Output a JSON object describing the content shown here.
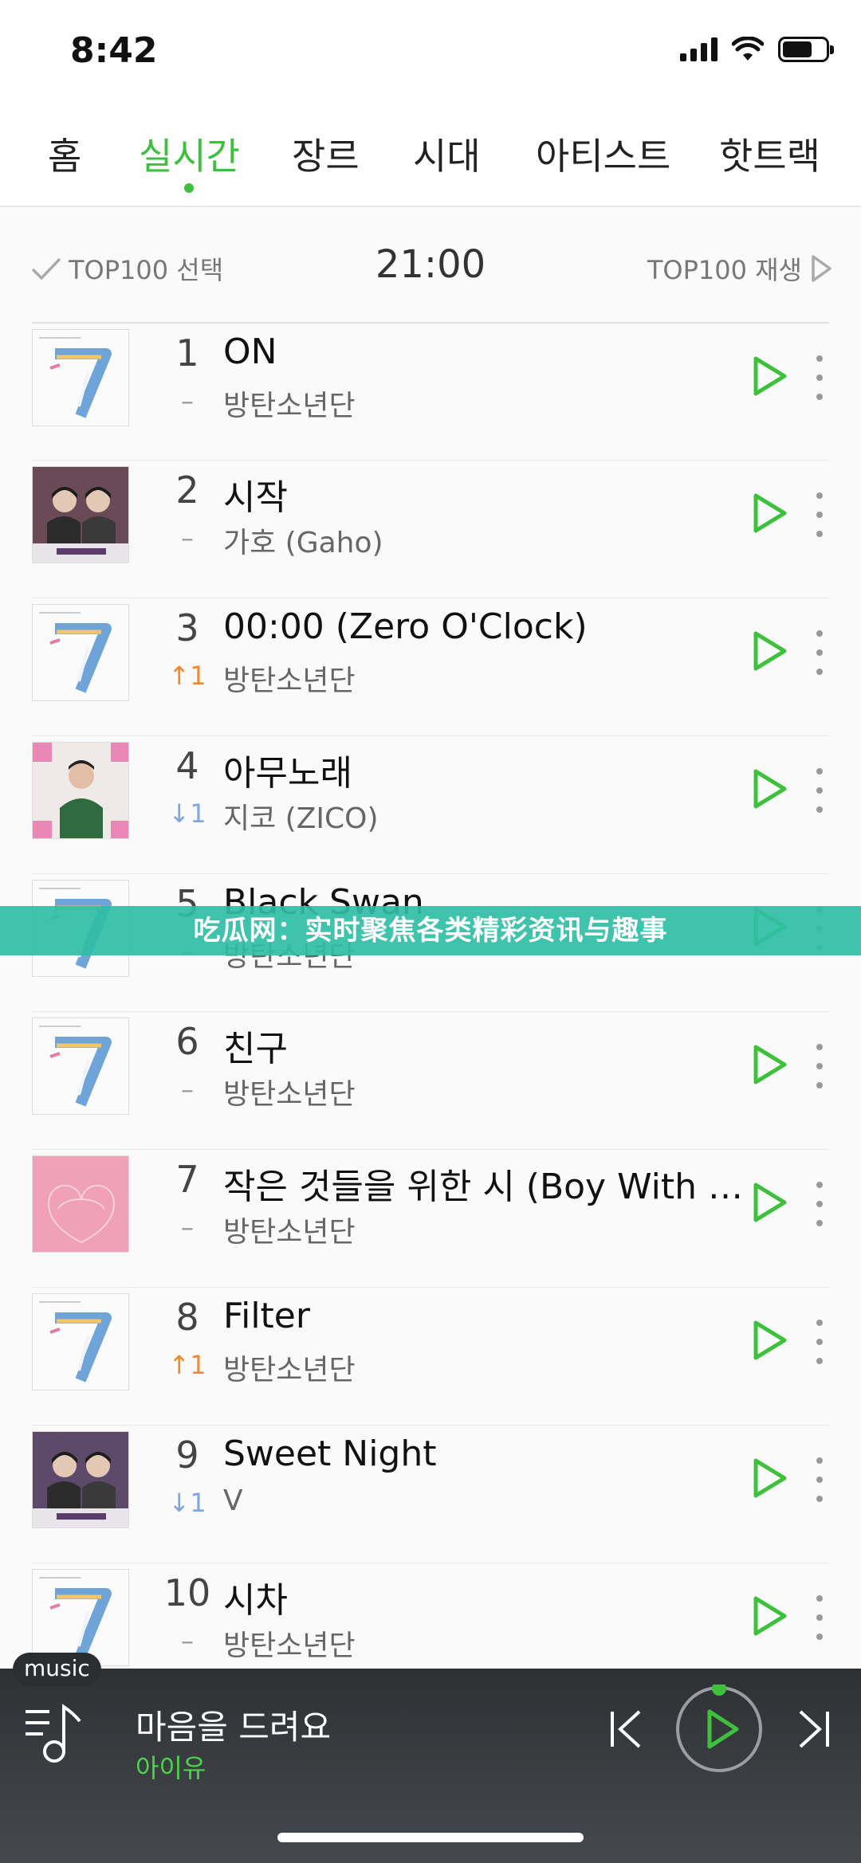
{
  "status": {
    "time": "8:42"
  },
  "tabs": [
    {
      "label": "홈",
      "active": false
    },
    {
      "label": "실시간",
      "active": true
    },
    {
      "label": "장르",
      "active": false
    },
    {
      "label": "시대",
      "active": false
    },
    {
      "label": "아티스트",
      "active": false
    },
    {
      "label": "핫트랙",
      "active": false
    }
  ],
  "subheader": {
    "select_label": "TOP100 선택",
    "time": "21:00",
    "play_label": "TOP100 재생"
  },
  "songs": [
    {
      "rank": "1",
      "change": "–",
      "change_dir": "none",
      "title": "ON",
      "artist": "방탄소년단",
      "cover": "bts7"
    },
    {
      "rank": "2",
      "change": "–",
      "change_dir": "none",
      "title": "시작",
      "artist": "가호 (Gaho)",
      "cover": "itaewon"
    },
    {
      "rank": "3",
      "change": "↑1",
      "change_dir": "up",
      "title": "00:00 (Zero O'Clock)",
      "artist": "방탄소년단",
      "cover": "bts7"
    },
    {
      "rank": "4",
      "change": "↓1",
      "change_dir": "down",
      "title": "아무노래",
      "artist": "지코 (ZICO)",
      "cover": "zico"
    },
    {
      "rank": "5",
      "change": "–",
      "change_dir": "none",
      "title": "Black Swan",
      "artist": "방탄소년단",
      "cover": "bts7"
    },
    {
      "rank": "6",
      "change": "–",
      "change_dir": "none",
      "title": "친구",
      "artist": "방탄소년단",
      "cover": "bts7"
    },
    {
      "rank": "7",
      "change": "–",
      "change_dir": "none",
      "title": "작은 것들을 위한 시 (Boy With L…",
      "artist": "방탄소년단",
      "cover": "persona"
    },
    {
      "rank": "8",
      "change": "↑1",
      "change_dir": "up",
      "title": "Filter",
      "artist": "방탄소년단",
      "cover": "bts7"
    },
    {
      "rank": "9",
      "change": "↓1",
      "change_dir": "down",
      "title": "Sweet Night",
      "artist": "V",
      "cover": "itaewon2"
    },
    {
      "rank": "10",
      "change": "–",
      "change_dir": "none",
      "title": "시차",
      "artist": "방탄소년단",
      "cover": "bts7"
    }
  ],
  "banner": {
    "text": "吃瓜网：实时聚焦各类精彩资讯与趣事"
  },
  "player": {
    "tag": "music",
    "title": "마음을 드려요",
    "artist": "아이유"
  },
  "colors": {
    "accent": "#3dc13c",
    "up": "#f08a2c",
    "down": "#7ea6e0"
  }
}
